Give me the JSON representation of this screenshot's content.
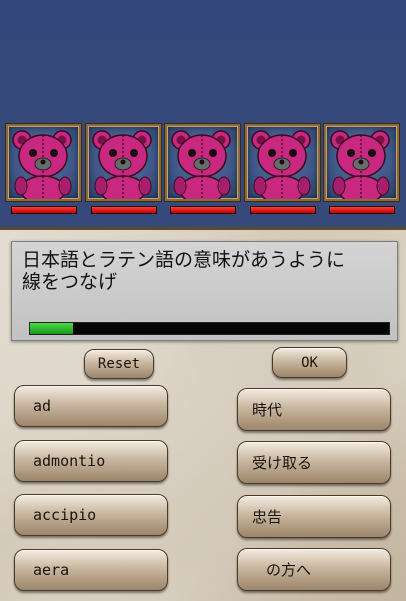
{
  "enemies": [
    {
      "name": "pink-bear",
      "hp": 1.0
    },
    {
      "name": "pink-bear",
      "hp": 1.0
    },
    {
      "name": "pink-bear",
      "hp": 1.0
    },
    {
      "name": "pink-bear",
      "hp": 1.0
    },
    {
      "name": "pink-bear",
      "hp": 1.0
    }
  ],
  "prompt": {
    "text": "日本語とラテン語の意味があうように\n線をつなげ"
  },
  "progress": 0.12,
  "controls": {
    "reset_label": "Reset",
    "ok_label": "OK"
  },
  "latin_words": [
    "ad",
    "admontio",
    "accipio",
    "aera"
  ],
  "japanese_words": [
    "時代",
    "受け取る",
    "忠告",
    "の方へ"
  ],
  "colors": {
    "sky": "#34497a",
    "hp_bar": "#e21b1b",
    "progress_fill": "#2fbd2f",
    "bear": "#c8287f"
  }
}
